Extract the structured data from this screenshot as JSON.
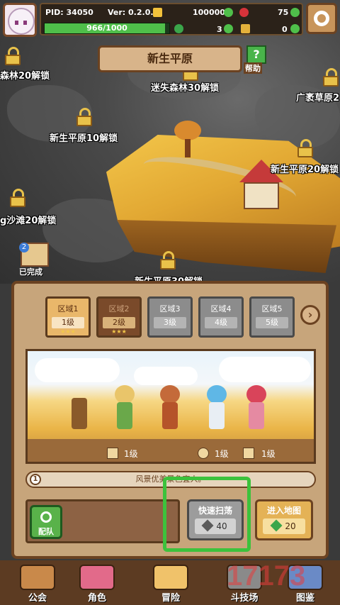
{
  "hud": {
    "pid": "PID: 34050",
    "version": "Ver: 0.2.0.3",
    "gold": "100000",
    "gems": "75",
    "xp_text": "966/1000",
    "xp_fraction": 0.966,
    "clovers": "3",
    "keys": "0"
  },
  "stage_title": "新生平原",
  "help_label": "帮助",
  "map_labels": {
    "top_left": "森林20解锁",
    "top_center": "迷失森林30解锁",
    "top_right": "广袤草原2",
    "mid_left": "新生平原10解锁",
    "mid_right": "新生平原20解锁",
    "low_left": "g沙滩20解锁",
    "low_center": "新生平原30解锁"
  },
  "done_badge": {
    "count": "2",
    "label": "已完成"
  },
  "zones": [
    {
      "name": "区域1",
      "level": "1级",
      "state": "active",
      "stars": "★★★"
    },
    {
      "name": "区域2",
      "level": "2级",
      "state": "unlocked",
      "stars": "★★★"
    },
    {
      "name": "区域3",
      "level": "3级",
      "state": "locked",
      "stars": ""
    },
    {
      "name": "区域4",
      "level": "4级",
      "state": "locked",
      "stars": ""
    },
    {
      "name": "区域5",
      "level": "5级",
      "state": "locked",
      "stars": ""
    }
  ],
  "next_arrow": "›",
  "levels": {
    "weapon": "1级",
    "orb": "1级",
    "sword": "1级"
  },
  "message": {
    "index": "1",
    "text": "风景优美景色宜人。"
  },
  "team_label": "配队",
  "sweep": {
    "label": "快速扫荡",
    "cost": "40"
  },
  "enter_map": {
    "label": "进入地图",
    "cost": "20"
  },
  "nav": [
    {
      "label": "公会"
    },
    {
      "label": "角色"
    },
    {
      "label": "冒险"
    },
    {
      "label": "斗技场"
    },
    {
      "label": "图鉴"
    }
  ],
  "watermark": "17173",
  "colors": {
    "highlight": "#3cc23c",
    "xp_fill": "#4fbf4a"
  }
}
